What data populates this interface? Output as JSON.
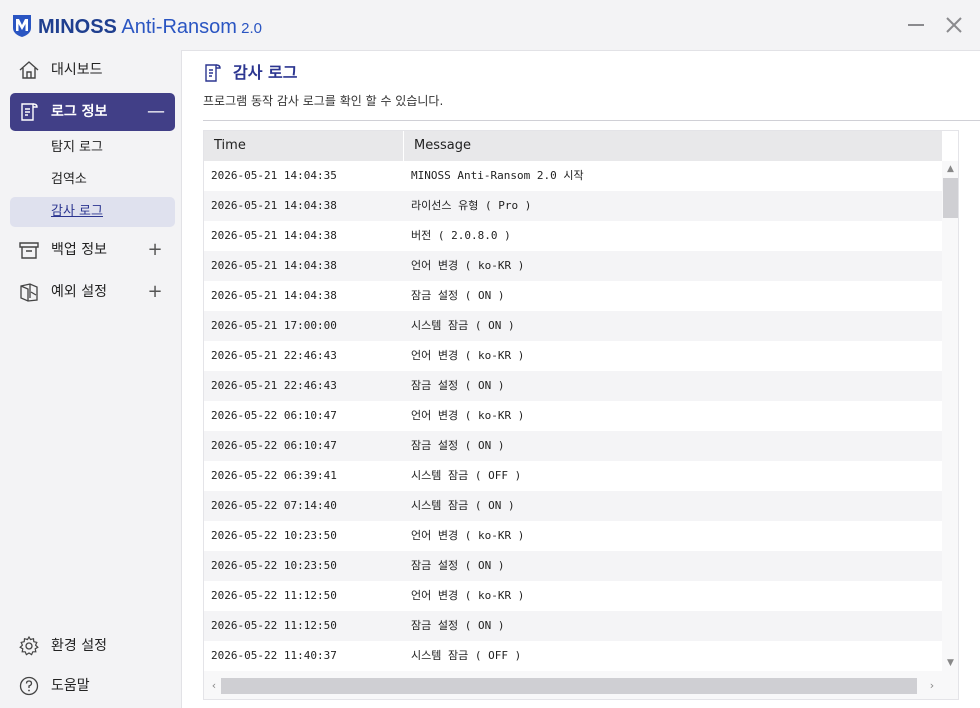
{
  "app": {
    "brand": "MINOSS",
    "product": " Anti-Ransom",
    "version": " 2.0"
  },
  "sidebar": {
    "items": [
      {
        "label": "대시보드",
        "icon": "home-icon"
      },
      {
        "label": "로그 정보",
        "icon": "log-icon",
        "toggle": "—"
      },
      {
        "label": "백업 정보",
        "icon": "archive-icon",
        "toggle": "+"
      },
      {
        "label": "예외 설정",
        "icon": "exception-icon",
        "toggle": "+"
      }
    ],
    "subitems": [
      {
        "label": "탐지 로그"
      },
      {
        "label": "검역소"
      },
      {
        "label": "감사 로그"
      }
    ],
    "bottom": [
      {
        "label": "환경 설정",
        "icon": "gear-icon"
      },
      {
        "label": "도움말",
        "icon": "help-icon"
      }
    ]
  },
  "page": {
    "title": "감사 로그",
    "description": "프로그램 동작 감사 로그를 확인 할 수 있습니다."
  },
  "table": {
    "headers": {
      "time": "Time",
      "message": "Message"
    },
    "rows": [
      {
        "time": "2026-05-21 14:04:35",
        "message": "MINOSS Anti-Ransom 2.0 시작"
      },
      {
        "time": "2026-05-21 14:04:38",
        "message": "라이선스 유형 ( Pro )"
      },
      {
        "time": "2026-05-21 14:04:38",
        "message": "버전 ( 2.0.8.0 )"
      },
      {
        "time": "2026-05-21 14:04:38",
        "message": "언어 변경 ( ko-KR )"
      },
      {
        "time": "2026-05-21 14:04:38",
        "message": "잠금 설정 ( ON )"
      },
      {
        "time": "2026-05-21 17:00:00",
        "message": "시스템 잠금 ( ON )"
      },
      {
        "time": "2026-05-21 22:46:43",
        "message": "언어 변경 ( ko-KR )"
      },
      {
        "time": "2026-05-21 22:46:43",
        "message": "잠금 설정 ( ON )"
      },
      {
        "time": "2026-05-22 06:10:47",
        "message": "언어 변경 ( ko-KR )"
      },
      {
        "time": "2026-05-22 06:10:47",
        "message": "잠금 설정 ( ON )"
      },
      {
        "time": "2026-05-22 06:39:41",
        "message": "시스템 잠금 ( OFF )"
      },
      {
        "time": "2026-05-22 07:14:40",
        "message": "시스템 잠금 ( ON )"
      },
      {
        "time": "2026-05-22 10:23:50",
        "message": "언어 변경 ( ko-KR )"
      },
      {
        "time": "2026-05-22 10:23:50",
        "message": "잠금 설정 ( ON )"
      },
      {
        "time": "2026-05-22 11:12:50",
        "message": "언어 변경 ( ko-KR )"
      },
      {
        "time": "2026-05-22 11:12:50",
        "message": "잠금 설정 ( ON )"
      },
      {
        "time": "2026-05-22 11:40:37",
        "message": "시스템 잠금 ( OFF )"
      }
    ]
  },
  "colors": {
    "accent": "#413f87",
    "title_blue": "#2b3590",
    "brand_blue": "#1f3f8f"
  }
}
